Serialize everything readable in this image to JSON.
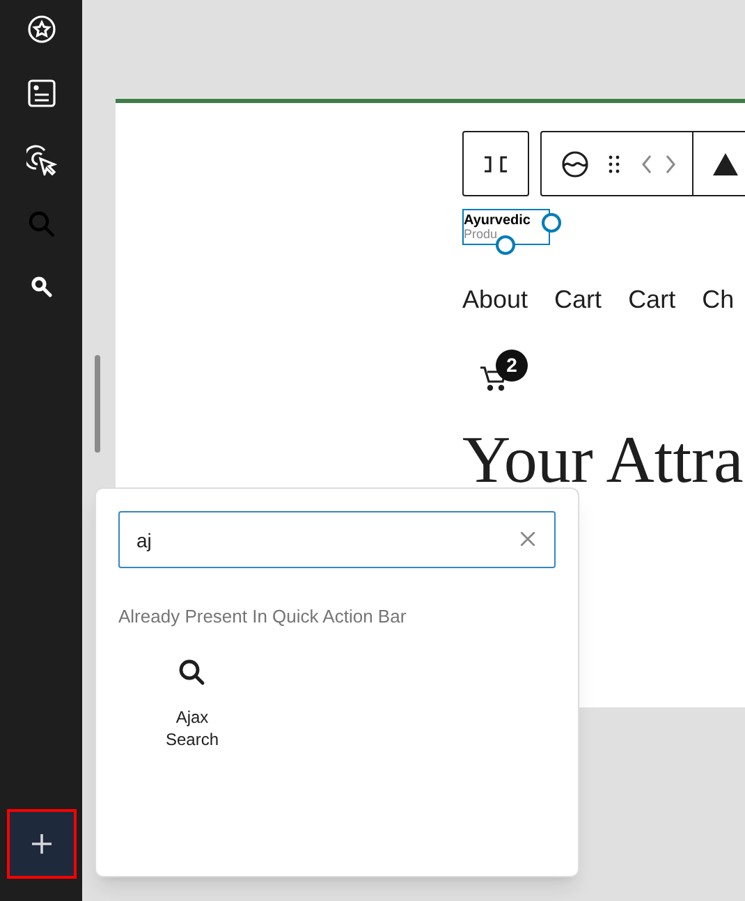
{
  "canvas": {
    "logo": {
      "title": "Ayurvedic",
      "subtitle": "Produ"
    },
    "nav": [
      "About",
      "Cart",
      "Cart",
      "Ch"
    ],
    "cart_badge": "2",
    "heading": "Your Attra"
  },
  "inserter": {
    "search": {
      "value": "aj"
    },
    "section_label": "Already Present In Quick Action Bar",
    "results": [
      {
        "label": "Ajax Search"
      }
    ]
  }
}
